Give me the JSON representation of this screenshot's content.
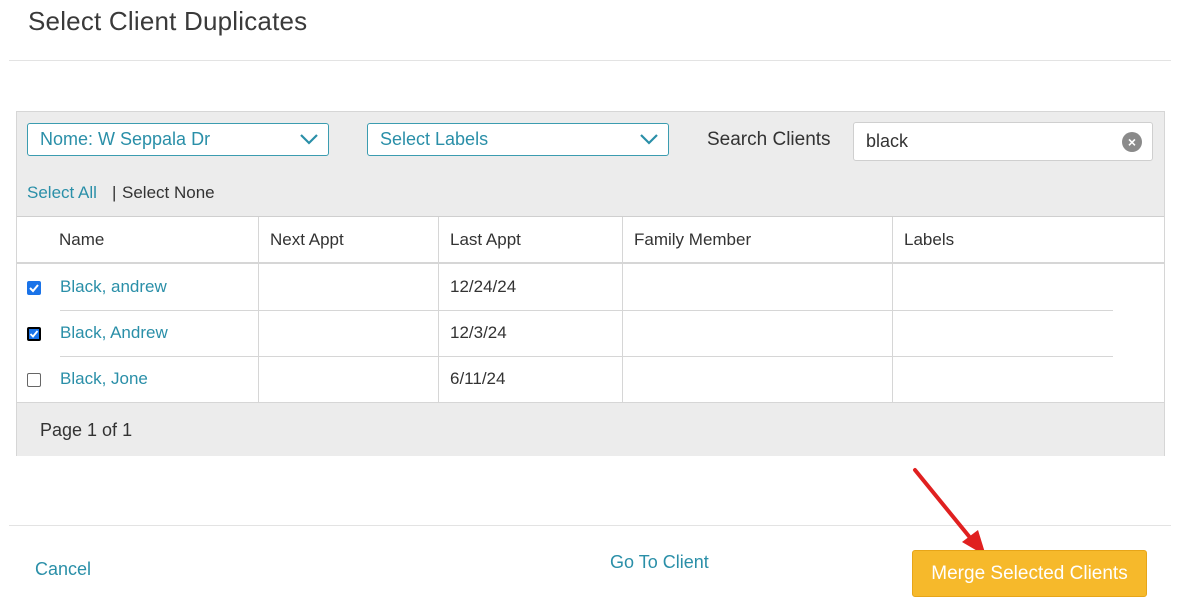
{
  "page": {
    "title": "Select Client Duplicates"
  },
  "filters": {
    "location_dropdown": "Nome: W Seppala Dr",
    "labels_dropdown": "Select Labels",
    "search_label": "Search Clients",
    "search_value": "black"
  },
  "selection": {
    "select_all": "Select All",
    "separator": "|",
    "select_none": "Select None"
  },
  "table": {
    "columns": [
      "Name",
      "Next Appt",
      "Last Appt",
      "Family Member",
      "Labels"
    ],
    "rows": [
      {
        "checked": true,
        "name": "Black, andrew",
        "next_appt": "",
        "last_appt": "12/24/24",
        "family_member": "",
        "labels": ""
      },
      {
        "checked": true,
        "name": "Black, Andrew",
        "next_appt": "",
        "last_appt": "12/3/24",
        "family_member": "",
        "labels": ""
      },
      {
        "checked": false,
        "name": "Black, Jone",
        "next_appt": "",
        "last_appt": "6/11/24",
        "family_member": "",
        "labels": ""
      }
    ],
    "pagination": "Page 1 of 1"
  },
  "footer": {
    "cancel": "Cancel",
    "go_to_client": "Go To Client",
    "merge": "Merge Selected Clients"
  },
  "colors": {
    "accent": "#2a8fa8",
    "merge_button": "#f6b92b",
    "arrow": "#e02020",
    "checkbox": "#1a73e8"
  }
}
